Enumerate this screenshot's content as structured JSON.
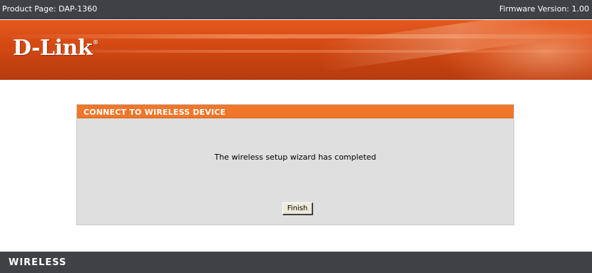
{
  "topbar": {
    "product_label": "Product Page: DAP-1360",
    "firmware_label": "Firmware Version: 1.00"
  },
  "header": {
    "logo_text": "D-Link",
    "logo_registered": "®"
  },
  "panel": {
    "title": "CONNECT TO WIRELESS DEVICE",
    "message": "The wireless setup wizard has completed",
    "finish_label": "Finish"
  },
  "footer": {
    "brand": "WIRELESS"
  },
  "colors": {
    "topbar": "#3f4145",
    "banner": "#d64b14",
    "panel_header": "#f07629",
    "panel_body": "#dfdfdf"
  }
}
